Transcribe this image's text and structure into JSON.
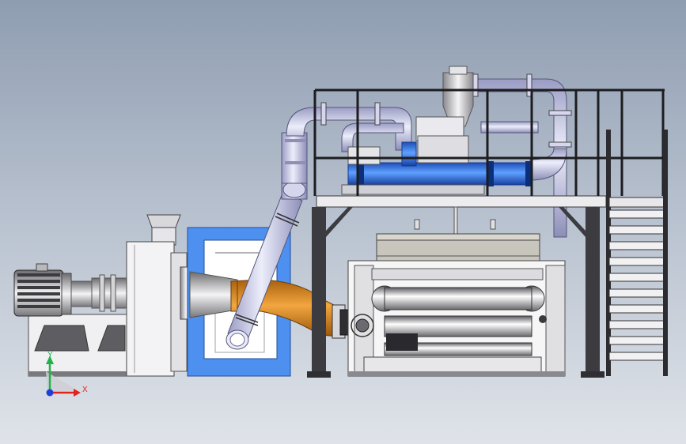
{
  "viewport": {
    "background_top": "#8f9db1",
    "background_bottom": "#dfe3e9"
  },
  "triad": {
    "x_label": "X",
    "y_label": "Y",
    "x_color": "#e0241b",
    "y_color": "#23b14d",
    "z_color": "#1f3fd6"
  },
  "model": {
    "pipe_color": "#c7c8e6",
    "blue_pipe_color": "#2f6fe0",
    "orange_duct_color": "#d9891e",
    "frame_color": "#3b3b40",
    "cabinet_color": "#4d90f0"
  }
}
